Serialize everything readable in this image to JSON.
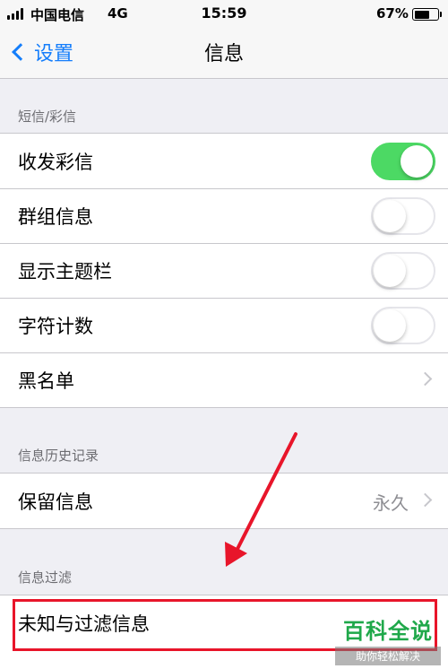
{
  "status_bar": {
    "carrier": "中国电信",
    "network": "4G",
    "time": "15:59",
    "battery_percent": "67%",
    "battery_level": 0.67
  },
  "nav": {
    "back_label": "设置",
    "title": "信息"
  },
  "sections": {
    "sms_mms": {
      "header": "短信/彩信",
      "rows": [
        {
          "label": "收发彩信",
          "toggle": true
        },
        {
          "label": "群组信息",
          "toggle": false
        },
        {
          "label": "显示主题栏",
          "toggle": false
        },
        {
          "label": "字符计数",
          "toggle": false
        },
        {
          "label": "黑名单"
        }
      ]
    },
    "history": {
      "header": "信息历史记录",
      "rows": [
        {
          "label": "保留信息",
          "value": "永久"
        }
      ]
    },
    "filter": {
      "header": "信息过滤",
      "rows": [
        {
          "label": "未知与过滤信息"
        }
      ]
    }
  },
  "watermark": {
    "main": "百科全说",
    "sub": "助你轻松解决"
  },
  "colors": {
    "accent": "#157efb",
    "toggle_on": "#4cd964",
    "annotation": "#e8152a",
    "watermark": "#1fa84a"
  }
}
